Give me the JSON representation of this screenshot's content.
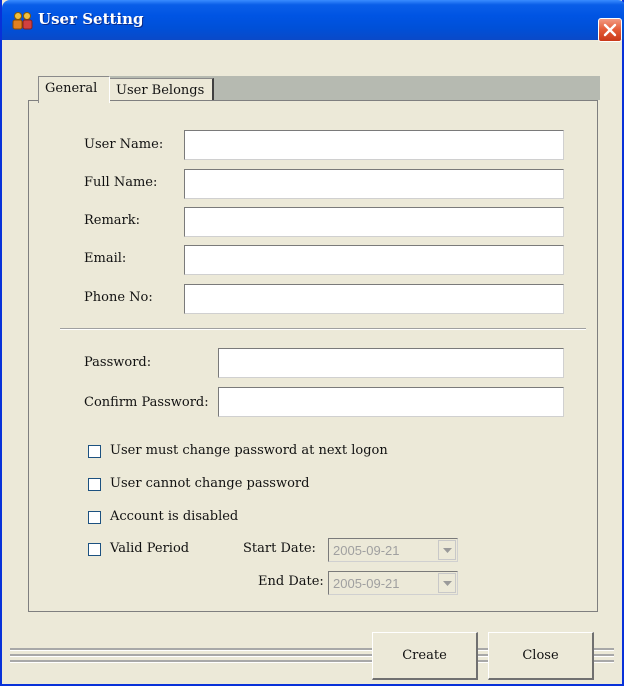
{
  "window": {
    "title": "User Setting"
  },
  "tabs": [
    {
      "label": "General",
      "active": true
    },
    {
      "label": "User Belongs",
      "active": false
    }
  ],
  "fields": {
    "user_name": {
      "label": "User Name:",
      "value": ""
    },
    "full_name": {
      "label": "Full Name:",
      "value": ""
    },
    "remark": {
      "label": "Remark:",
      "value": ""
    },
    "email": {
      "label": "Email:",
      "value": ""
    },
    "phone": {
      "label": "Phone No:",
      "value": ""
    },
    "password": {
      "label": "Password:",
      "value": ""
    },
    "confirm_password": {
      "label": "Confirm Password:",
      "value": ""
    }
  },
  "options": {
    "must_change": {
      "label": "User must change password at next logon",
      "checked": false
    },
    "cannot_change": {
      "label": "User cannot change password",
      "checked": false
    },
    "disabled": {
      "label": "Account is disabled",
      "checked": false
    },
    "valid_period": {
      "label": "Valid Period",
      "checked": false
    }
  },
  "dates": {
    "start": {
      "label": "Start Date:",
      "value": "2005-09-21"
    },
    "end": {
      "label": "End Date:",
      "value": "2005-09-21"
    }
  },
  "buttons": {
    "create": "Create",
    "close": "Close"
  },
  "colors": {
    "title_bar": "#0054e3",
    "close_button": "#e35a36",
    "panel": "#ece9d8"
  },
  "icons": {
    "app": "users-icon",
    "close": "close-icon",
    "dropdown": "chevron-down-icon"
  }
}
